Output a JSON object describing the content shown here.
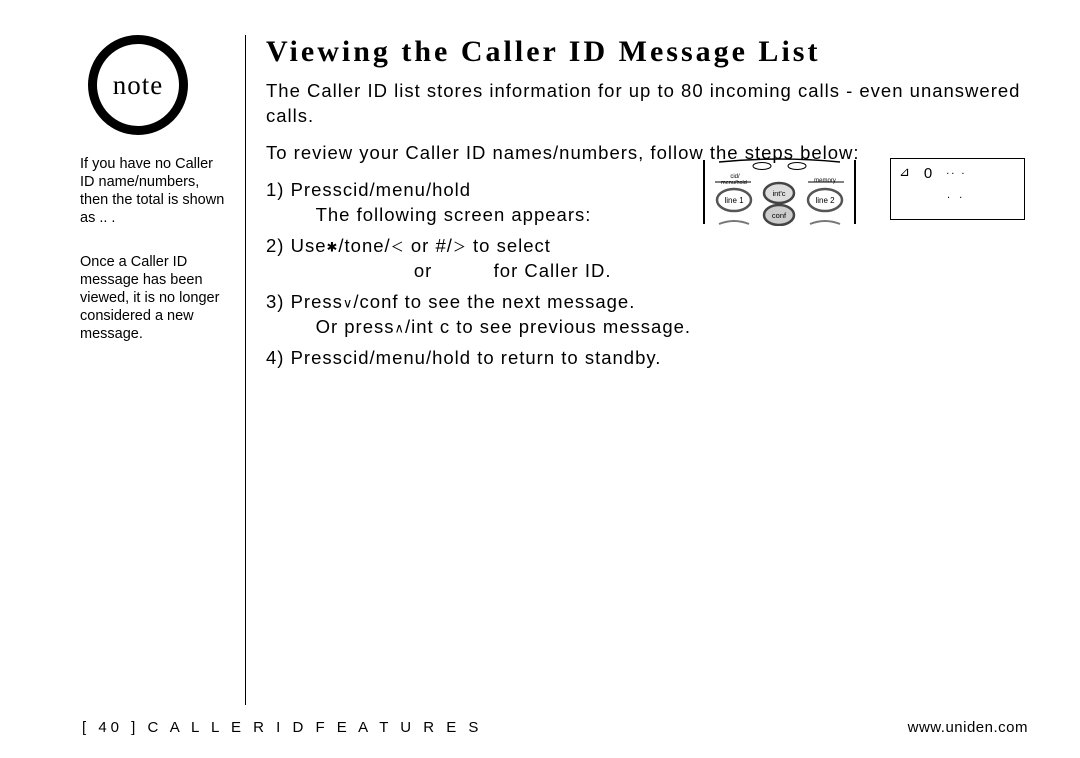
{
  "sidebar": {
    "noteLabel": "note",
    "para1": "If you have no Caller ID name/numbers, then the total is shown as .. .",
    "para2": "Once a Caller ID message has been viewed, it is no longer considered a new message."
  },
  "main": {
    "heading": "Viewing the Caller ID Message List",
    "intro1": "The Caller ID list stores information for up to 80 incoming calls - even unanswered calls.",
    "intro2": "To review your Caller ID names/numbers, follow the steps below:",
    "steps": {
      "s1a": "1) Press",
      "s1key1": "cid/menu/hold",
      "s1b": "\n    The following screen appears:",
      "s2a": "2) Use",
      "s2key1": "/tone/",
      "s2mid": " or #/",
      "s2b": " to select\n                    or          for Caller ID.",
      "s3a": "3) Press",
      "s3key1": "/conf",
      "s3b": " to see the next message.\n    Or press",
      "s3key2": "/int c",
      "s3c": " to see previous message.",
      "s4a": "4) Press",
      "s4key1": "cid/menu/hold",
      "s4b": " to return to standby."
    },
    "display": {
      "zero": "0",
      "dots1": ".. .",
      "dots2": ". ."
    }
  },
  "footer": {
    "left": "[ 40 ] C A L L E R  I D  F E A T U R E S",
    "right": "www.uniden.com"
  }
}
